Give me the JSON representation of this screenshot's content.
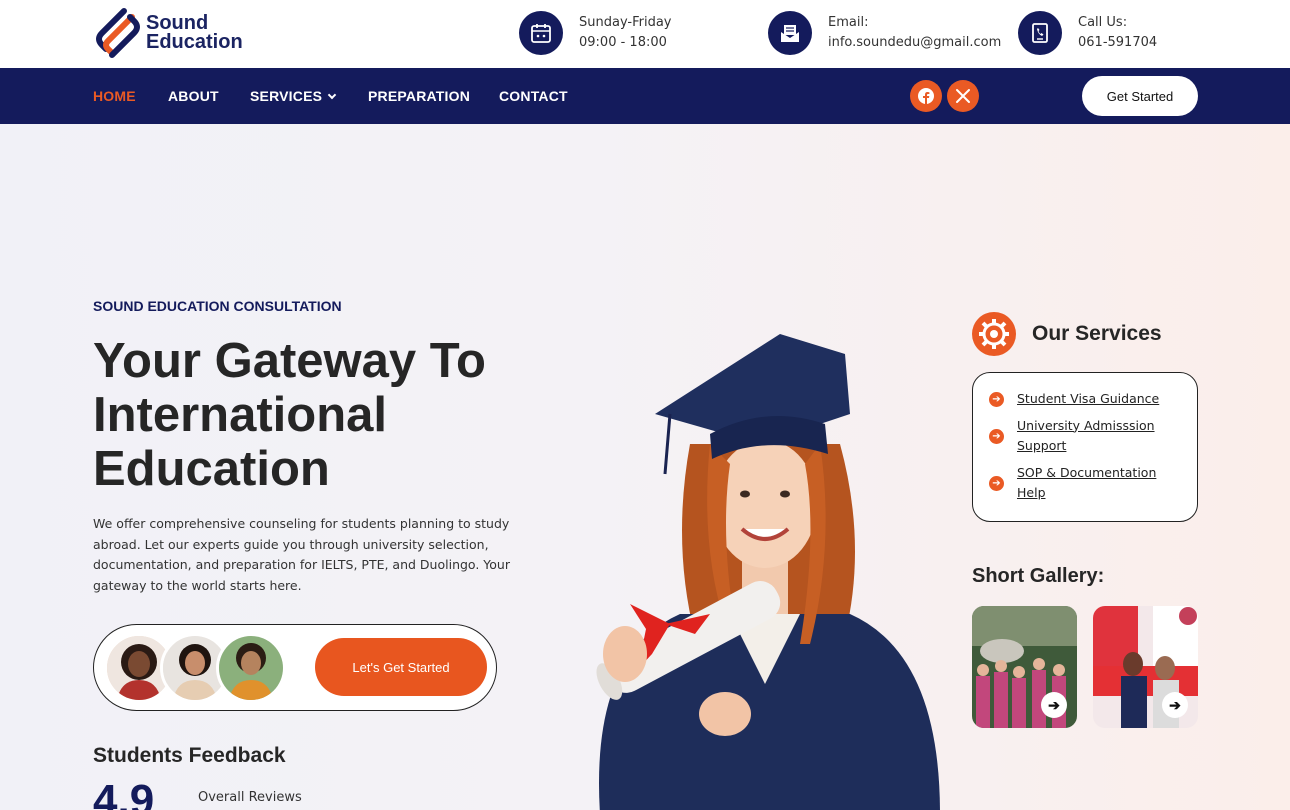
{
  "brand": {
    "line1": "Sound",
    "line2": "Education",
    "primary": "#141b5c",
    "accent": "#ea5a24"
  },
  "contact": [
    {
      "icon": "calendar-icon",
      "label": "Sunday-Friday",
      "value": "09:00 - 18:00"
    },
    {
      "icon": "email-icon",
      "label": "Email:",
      "value": "info.soundedu@gmail.com"
    },
    {
      "icon": "phone-book-icon",
      "label": "Call Us:",
      "value": "061-591704"
    }
  ],
  "nav": {
    "home": "HOME",
    "about": "ABOUT",
    "services": "SERVICES",
    "preparation": "PREPARATION",
    "contact": "CONTACT",
    "cta": "Get Started",
    "social": [
      "facebook-icon",
      "x-twitter-icon"
    ]
  },
  "hero": {
    "eyebrow": "SOUND EDUCATION CONSULTATION",
    "title": "Your Gateway To International Education",
    "description": "We offer comprehensive counseling for students planning to study abroad. Let our experts guide you through university selection, documentation, and preparation for IELTS, PTE, and Duolingo. Your gateway to the world starts here.",
    "cta": "Let's Get Started",
    "feedback_title": "Students Feedback",
    "rating": "4.9",
    "rating_label": "Overall Reviews"
  },
  "services": {
    "title": "Our Services",
    "items": [
      "Student Visa Guidance",
      "University Admisssion Support",
      "SOP & Documentation Help"
    ]
  },
  "gallery": {
    "title": "Short Gallery:"
  }
}
